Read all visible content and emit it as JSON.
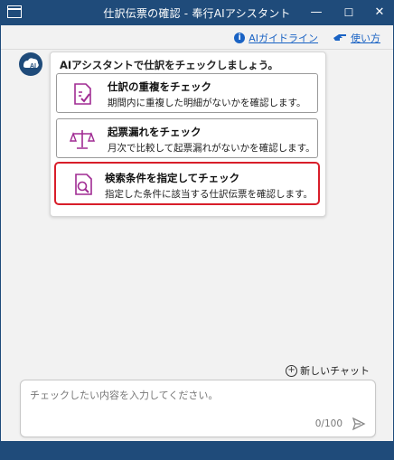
{
  "window": {
    "title": "仕訳伝票の確認 - 奉行AIアシスタント",
    "minimize": "—",
    "maximize": "☐",
    "close": "✕"
  },
  "header": {
    "guideline_label": "AIガイドライン",
    "howto_label": "使い方"
  },
  "assistant": {
    "avatar_text": "AI",
    "prompt": "AIアシスタントで仕訳をチェックしましょう。",
    "options": [
      {
        "title": "仕訳の重複をチェック",
        "desc": "期間内に重複した明細がないかを確認します。",
        "icon": "document-check-icon"
      },
      {
        "title": "起票漏れをチェック",
        "desc": "月次で比較して起票漏れがないかを確認します。",
        "icon": "scale-icon"
      },
      {
        "title": "検索条件を指定してチェック",
        "desc": "指定した条件に該当する仕訳伝票を確認します。",
        "icon": "document-search-icon",
        "selected": true
      }
    ]
  },
  "chat": {
    "new_chat_label": "新しいチャット",
    "placeholder": "チェックしたい内容を入力してください。",
    "counter": "0/100"
  },
  "colors": {
    "titlebar": "#1f4b7a",
    "accent_purple": "#a02b93",
    "selected_border": "#d81e2a",
    "link": "#1a63c4"
  }
}
